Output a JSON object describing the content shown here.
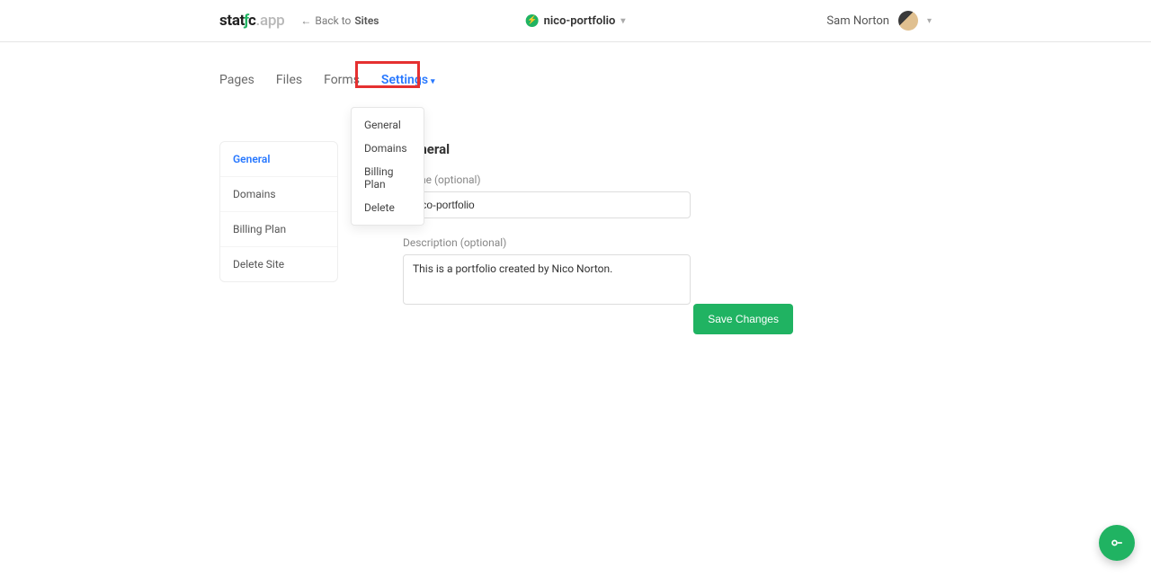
{
  "header": {
    "logo_prefix": "stat",
    "logo_bolt": "ƒ",
    "logo_suffix": "c",
    "logo_app": ".app",
    "back_arrow": "←",
    "back_text": "Back to",
    "back_sites": "Sites",
    "site_name": "nico-portfolio",
    "user_name": "Sam Norton"
  },
  "tabs": {
    "pages": "Pages",
    "files": "Files",
    "forms": "Forms",
    "settings": "Settings"
  },
  "settings_dropdown": {
    "general": "General",
    "domains": "Domains",
    "billing": "Billing Plan",
    "delete": "Delete"
  },
  "sidebar": {
    "general": "General",
    "domains": "Domains",
    "billing": "Billing Plan",
    "delete": "Delete Site"
  },
  "main": {
    "section_title": "General",
    "name_label": "Name (optional)",
    "name_value": "nico-portfolio",
    "desc_label": "Description (optional)",
    "desc_value": "This is a portfolio created by Nico Norton.",
    "save_label": "Save Changes"
  }
}
